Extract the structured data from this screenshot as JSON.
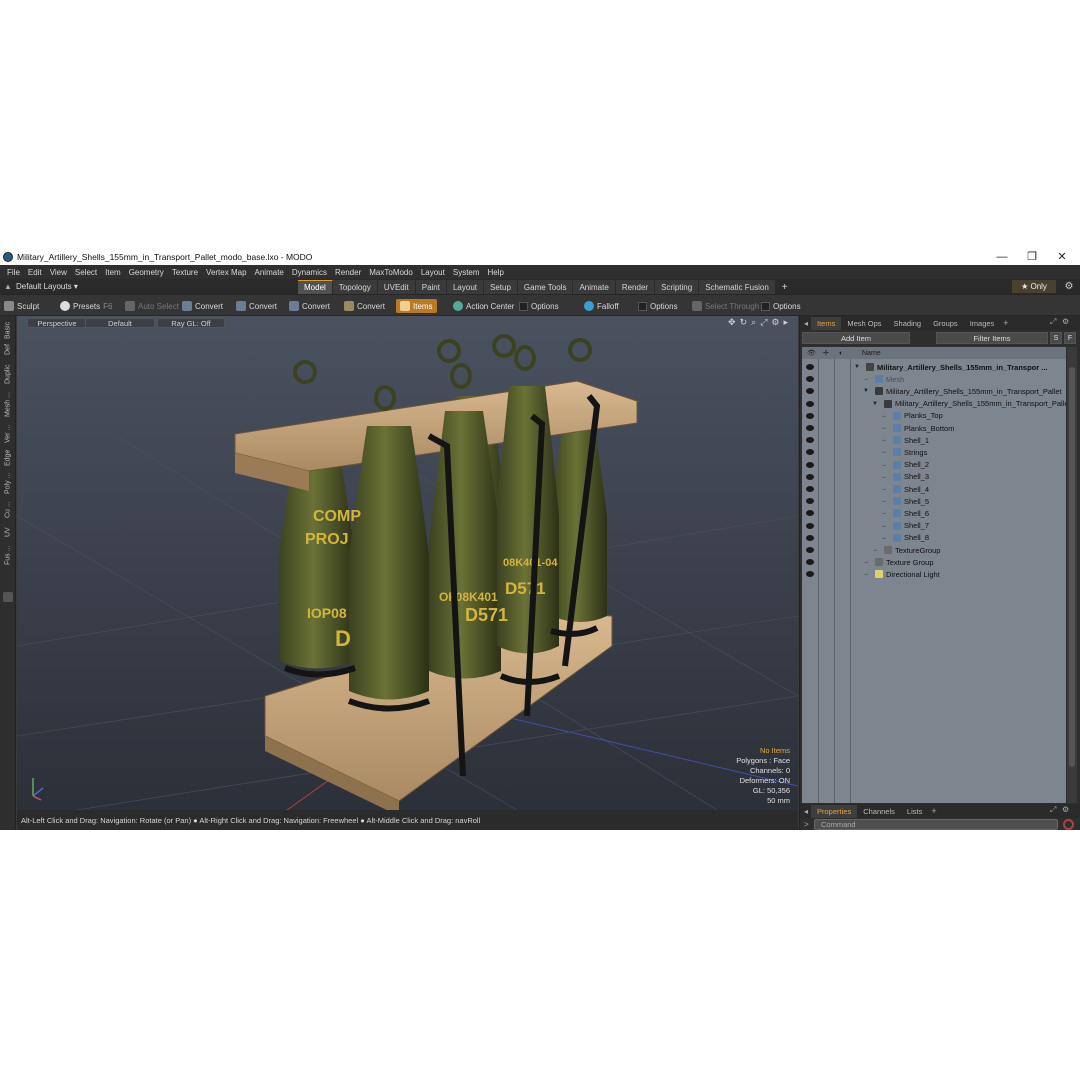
{
  "window": {
    "title": "Military_Artillery_Shells_155mm_in_Transport_Pallet_modo_base.lxo - MODO",
    "minimize": "—",
    "restore": "❐",
    "close": "✕"
  },
  "menu": [
    "File",
    "Edit",
    "View",
    "Select",
    "Item",
    "Geometry",
    "Texture",
    "Vertex Map",
    "Animate",
    "Dynamics",
    "Render",
    "MaxToModo",
    "Layout",
    "System",
    "Help"
  ],
  "layouts": {
    "label": "Default Layouts ▾",
    "tabs": [
      "Model",
      "Topology",
      "UVEdit",
      "Paint",
      "Layout",
      "Setup",
      "Game Tools",
      "Animate",
      "Render",
      "Scripting",
      "Schematic Fusion"
    ],
    "active_tab": "Model",
    "add": "+",
    "only": "★ Only"
  },
  "toolbar": {
    "sculpt": "Sculpt",
    "presets": "Presets",
    "presets_key": "F6",
    "auto_select": "Auto Select",
    "convert1": "Convert",
    "convert2": "Convert",
    "convert3": "Convert",
    "convert4": "Convert",
    "items": "Items",
    "action_center": "Action Center",
    "options1": "Options",
    "falloff": "Falloff",
    "options2": "Options",
    "select_through": "Select Through",
    "options3": "Options"
  },
  "left_tabs": [
    "Basic",
    "Def",
    "Duplic",
    "Mesh ...",
    "Ver ...",
    "Edge",
    "Poly ...",
    "Cu ...",
    "UV",
    "Fus ..."
  ],
  "viewport": {
    "view": "Perspective",
    "shading": "Default",
    "raygl": "Ray GL: Off",
    "info": {
      "no_items": "No Items",
      "polygons": "Polygons : Face",
      "channels": "Channels: 0",
      "deformers": "Deformers: ON",
      "gl": "GL: 50,356",
      "scale": "50 mm"
    },
    "shell_labels": [
      "COMP",
      "PROJ",
      "IOP08",
      "D",
      "OF08K401",
      "D571",
      "08K401-04",
      "D571"
    ]
  },
  "status": "Alt-Left Click and Drag: Navigation: Rotate (or Pan) ● Alt-Right Click and Drag: Navigation: Freewheel ● Alt-Middle Click and Drag: navRoll",
  "right_panel": {
    "tabs": [
      "Items",
      "Mesh Ops",
      "Shading",
      "Groups",
      "Images"
    ],
    "active_tab": "Items",
    "add_item": "Add Item",
    "filter_items": "Filter Items",
    "s_btn": "S",
    "f_btn": "F",
    "name_header": "Name",
    "items": [
      {
        "label": "Military_Artillery_Shells_155mm_in_Transpor ...",
        "indent": 0,
        "bold": true,
        "icon": "scene"
      },
      {
        "label": "Mesh",
        "indent": 1,
        "bold": false,
        "icon": "mesh",
        "dim": true
      },
      {
        "label": "Military_Artillery_Shells_155mm_in_Transport_Pallet",
        "indent": 1,
        "bold": false,
        "icon": "locator"
      },
      {
        "label": "Military_Artillery_Shells_155mm_in_Transport_Pallet",
        "indent": 2,
        "bold": false,
        "icon": "locator"
      },
      {
        "label": "Planks_Top",
        "indent": 3,
        "bold": false,
        "icon": "mesh"
      },
      {
        "label": "Planks_Bottom",
        "indent": 3,
        "bold": false,
        "icon": "mesh"
      },
      {
        "label": "Shell_1",
        "indent": 3,
        "bold": false,
        "icon": "mesh"
      },
      {
        "label": "Strings",
        "indent": 3,
        "bold": false,
        "icon": "mesh"
      },
      {
        "label": "Shell_2",
        "indent": 3,
        "bold": false,
        "icon": "mesh"
      },
      {
        "label": "Shell_3",
        "indent": 3,
        "bold": false,
        "icon": "mesh"
      },
      {
        "label": "Shell_4",
        "indent": 3,
        "bold": false,
        "icon": "mesh"
      },
      {
        "label": "Shell_5",
        "indent": 3,
        "bold": false,
        "icon": "mesh"
      },
      {
        "label": "Shell_6",
        "indent": 3,
        "bold": false,
        "icon": "mesh"
      },
      {
        "label": "Shell_7",
        "indent": 3,
        "bold": false,
        "icon": "mesh"
      },
      {
        "label": "Shell_8",
        "indent": 3,
        "bold": false,
        "icon": "mesh"
      },
      {
        "label": "TextureGroup",
        "indent": 2,
        "bold": false,
        "icon": "group"
      },
      {
        "label": "Texture Group",
        "indent": 1,
        "bold": false,
        "icon": "group"
      },
      {
        "label": "Directional Light",
        "indent": 1,
        "bold": false,
        "icon": "light"
      }
    ],
    "bottom_tabs": [
      "Properties",
      "Channels",
      "Lists"
    ],
    "bottom_active": "Properties",
    "command_placeholder": "Command"
  },
  "colors": {
    "accent": "#e6a43a",
    "shell": "#5b6230",
    "wood": "#c9a57a"
  }
}
